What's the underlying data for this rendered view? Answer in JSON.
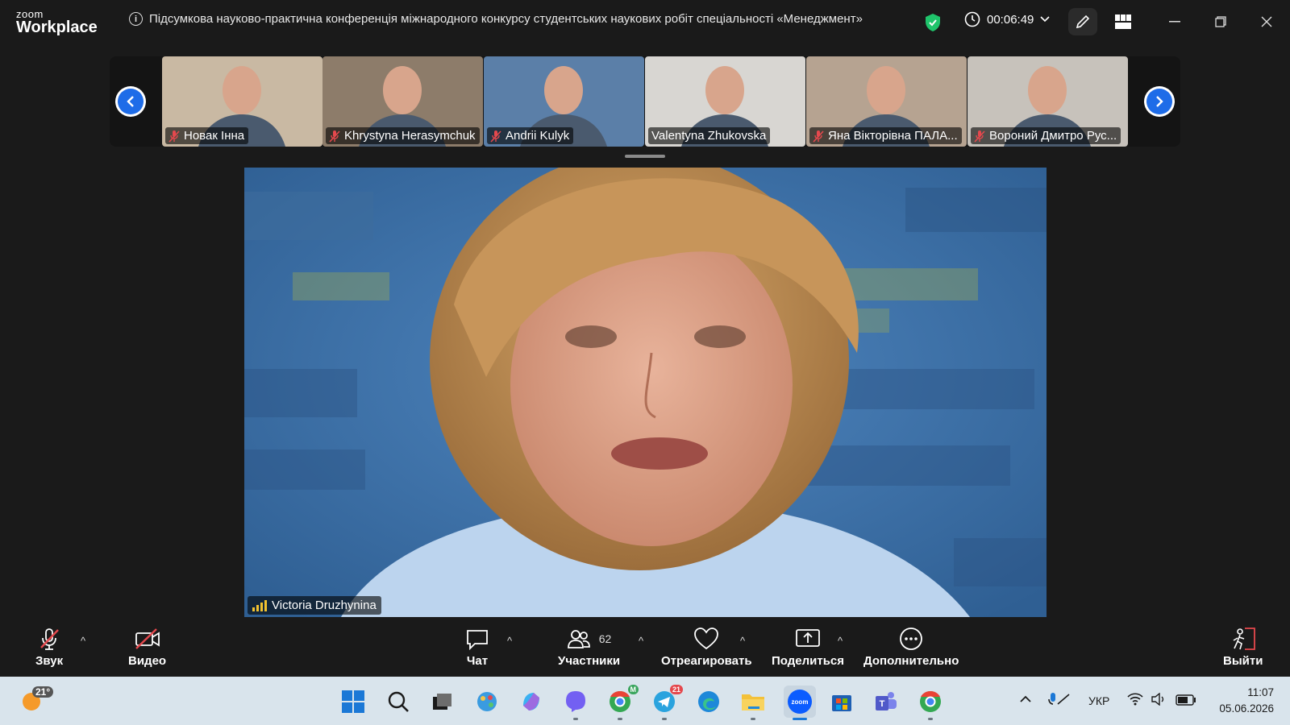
{
  "app": {
    "brand_small": "zoom",
    "brand_large": "Workplace"
  },
  "meeting": {
    "title": "Підсумкова науково-практична конференція міжнародного конкурсу студентських наукових робіт спеціальності «Менеджмент»",
    "timer": "00:06:49"
  },
  "gallery": {
    "participants": [
      {
        "name": "Новак Інна",
        "muted": true,
        "bg": "#c9b9a3"
      },
      {
        "name": "Khrystyna Herasymchuk",
        "muted": true,
        "bg": "#8d7c6a"
      },
      {
        "name": "Andrii Kulyk",
        "muted": true,
        "bg": "#5b7fa8"
      },
      {
        "name": "Valentyna Zhukovska",
        "muted": false,
        "bg": "#d8d6d2"
      },
      {
        "name": "Яна Вікторівна ПАЛА...",
        "muted": true,
        "bg": "#b6a391"
      },
      {
        "name": "Вороний Дмитро Рус...",
        "muted": true,
        "bg": "#c7c2bb"
      }
    ]
  },
  "speaker": {
    "name": "Victoria Druzhynina"
  },
  "toolbar": {
    "audio_label": "Звук",
    "video_label": "Видео",
    "chat_label": "Чат",
    "participants_label": "Участники",
    "participants_count": "62",
    "react_label": "Отреагировать",
    "share_label": "Поделиться",
    "more_label": "Дополнительно",
    "leave_label": "Выйти"
  },
  "taskbar": {
    "weather_temp": "21°",
    "language": "УКР",
    "time": "11:07",
    "date": "05.06.2026",
    "chrome_badge": "M",
    "telegram_badge": "21"
  },
  "colors": {
    "accent": "#1e6ce8",
    "muted_red": "#e5484d",
    "shield_green": "#1fc46b",
    "signal": "#f2c230"
  }
}
